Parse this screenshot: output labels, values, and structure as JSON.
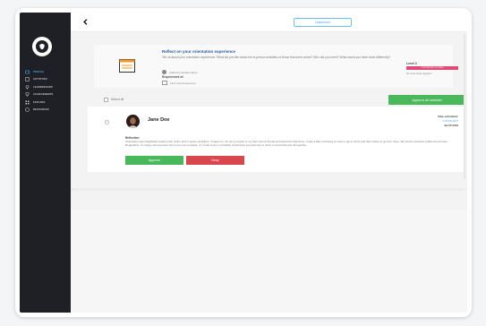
{
  "sidebar": {
    "items": [
      {
        "label": "Profile",
        "icon": "profile-icon",
        "active": true
      },
      {
        "label": "Activities",
        "icon": "list-icon"
      },
      {
        "label": "Leaderboard",
        "icon": "pin-icon"
      },
      {
        "label": "Achievements",
        "icon": "trophy-icon"
      },
      {
        "label": "Explore",
        "icon": "grid-icon"
      },
      {
        "label": "Resources",
        "icon": "info-icon"
      }
    ]
  },
  "topbar": {
    "dashboard_label": "Dashboard"
  },
  "activity": {
    "title": "Reflect on your orientation experience",
    "description": "Tell us about your orientation experience. What did you like about the in-person activities vs those that were online? Who did you meet? What would you have done differently?",
    "added_by": "Added by Estelle Hayes",
    "requirement_label": "Requirement of:",
    "requirement": "First Year Experience",
    "level_label": "Level 2",
    "level_badge": "Conversation Seed",
    "due_date": "No Due Date Applied"
  },
  "select_all": {
    "label": "Select all",
    "approve_all_label": "Approve all selected"
  },
  "submission": {
    "student_name": "Jane Doe",
    "date_label": "Date submitted:",
    "time": "2:29 PM EST",
    "date": "Jul 25 2019",
    "reflection_label": "Reflection",
    "reflection_text": "Orientation was delightfully helpful, both online and in person activities. I happen to run into a couple of my high school friends and had lunch with them. It was a little confusing on how to get to lunch and then where to go from there. We found ourselves a little lost at times. Regardless, I'm happy all necessary forms are now complete. If I could re-do it I probably would have just planned on lunch to avoid that part all together.",
    "approve_label": "Approve",
    "deny_label": "Deny"
  },
  "colors": {
    "sidebar_bg": "#1e2025",
    "accent": "#4aa8f0",
    "approve": "#49b85a",
    "deny": "#d7474d",
    "level_badge": "#e04a7a",
    "title": "#2b5aa0"
  }
}
